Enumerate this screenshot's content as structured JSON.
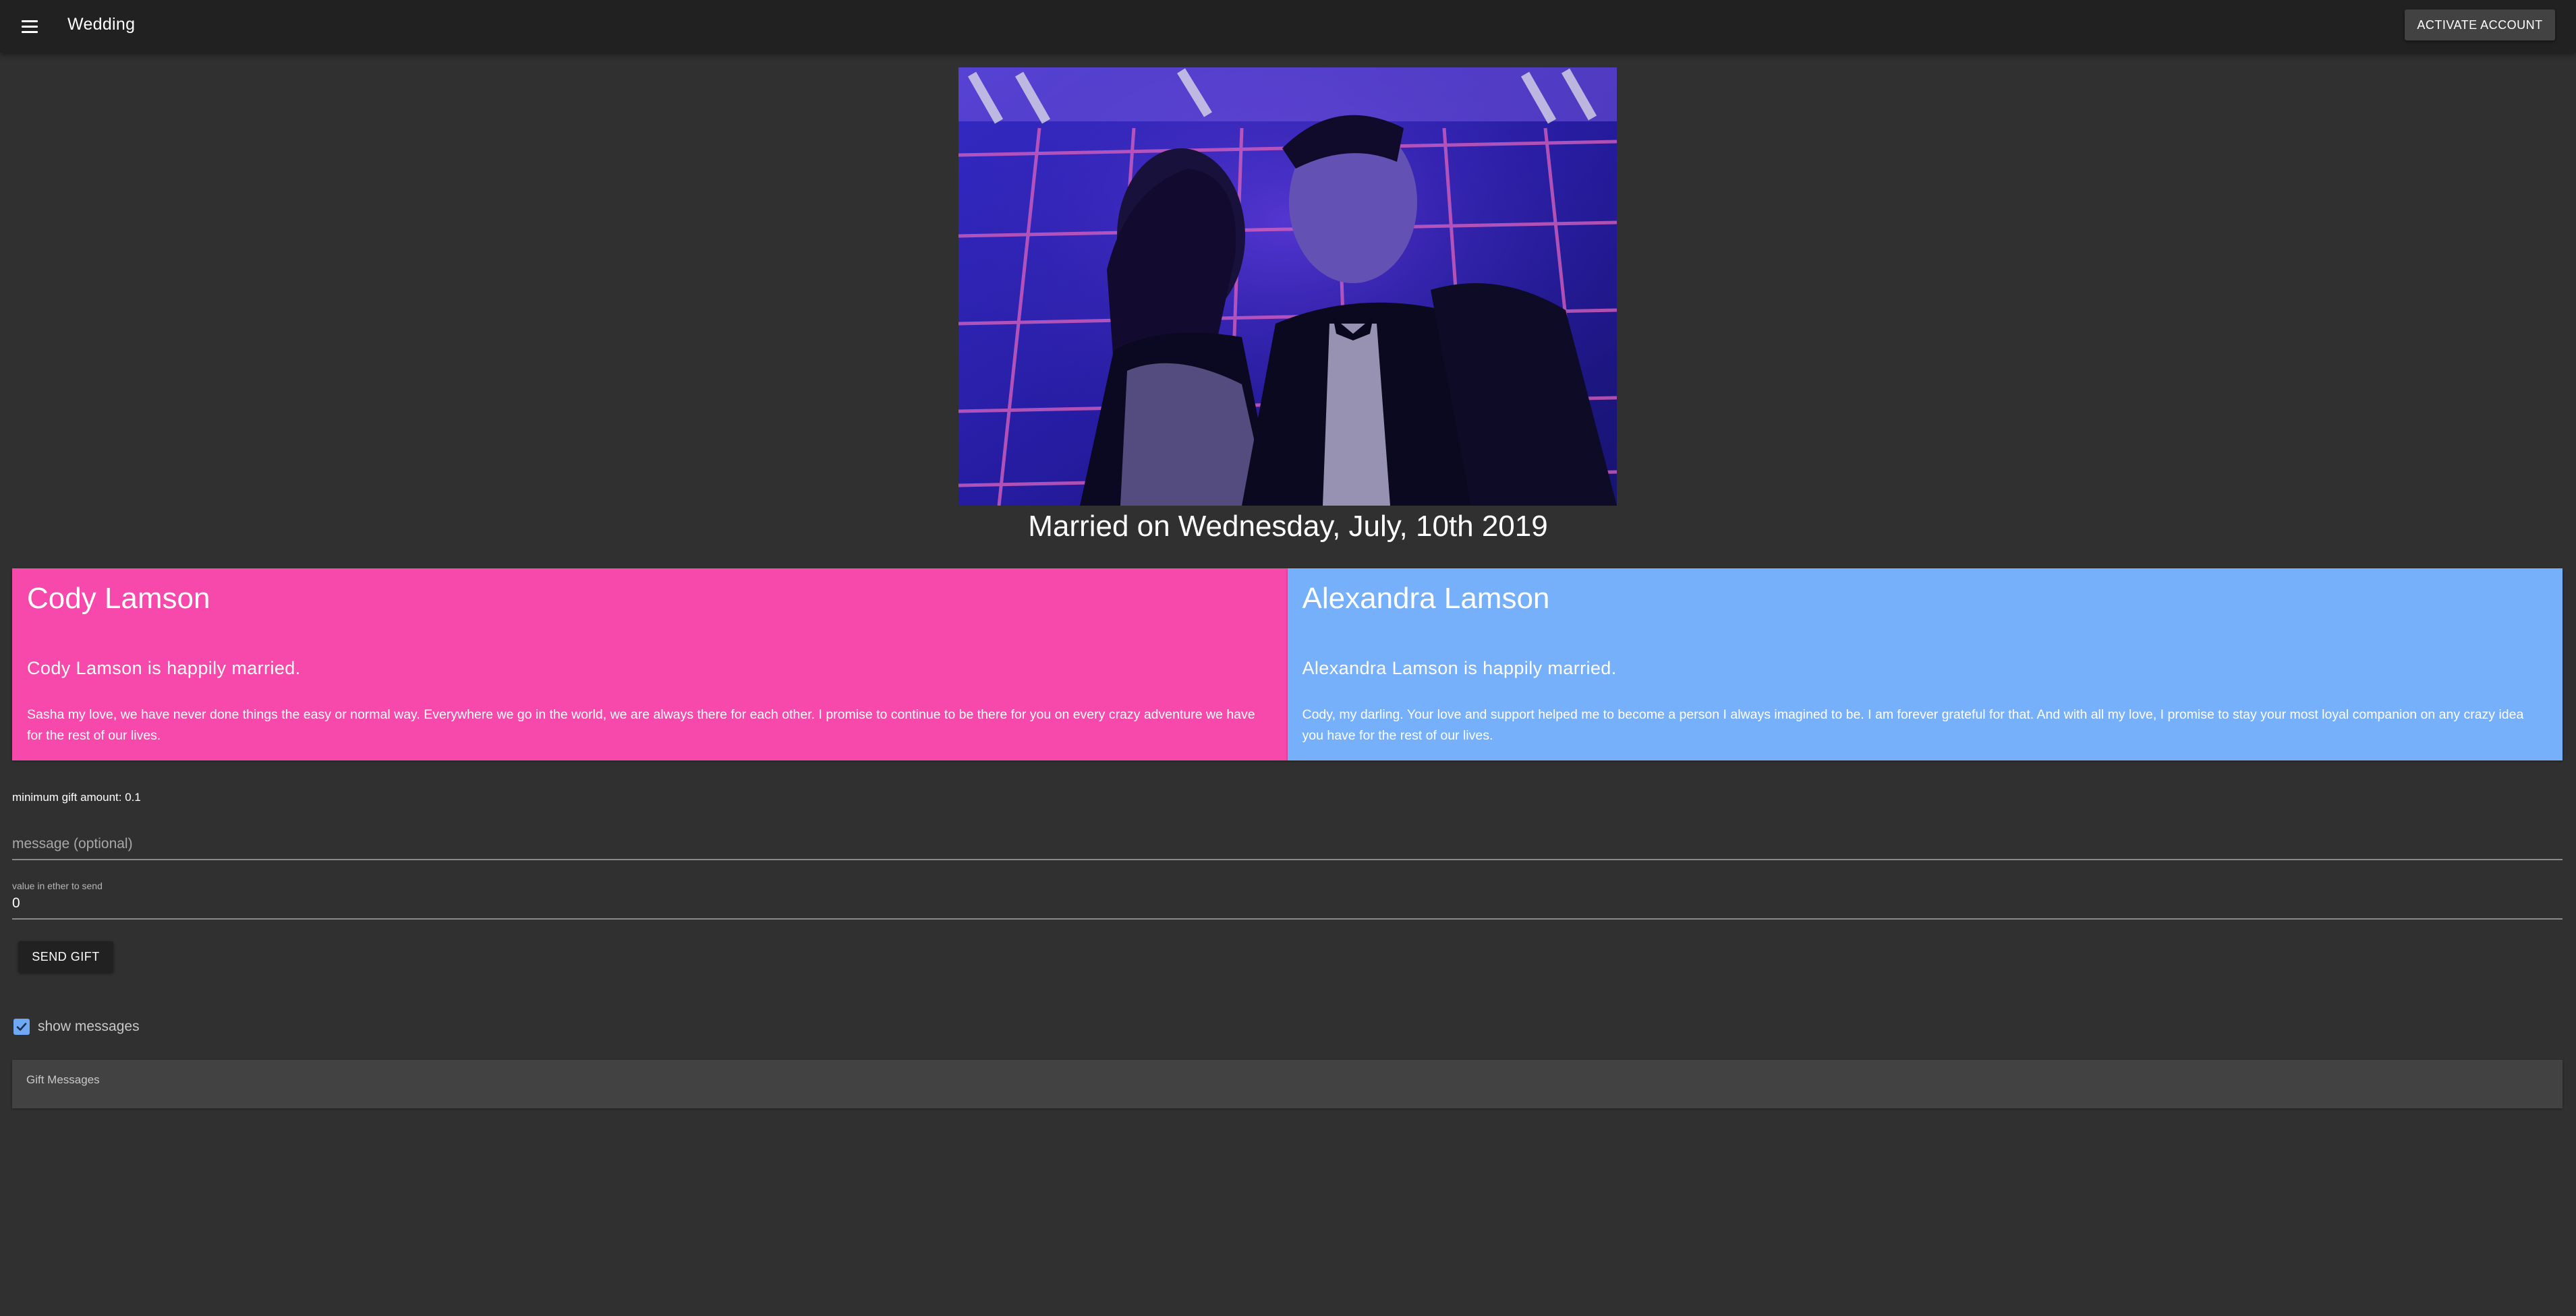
{
  "app_bar": {
    "menu_icon": "menu-icon",
    "title": "Wedding",
    "activate_label": "ACTIVATE ACCOUNT"
  },
  "hero": {
    "image_description": "couple-photo",
    "married_text": "Married on Wednesday, July, 10th 2019"
  },
  "partners": [
    {
      "name": "Cody Lamson",
      "status": "Cody Lamson is happily married.",
      "vow": "Sasha my love, we have never done things the easy or normal way. Everywhere we go in the world, we are always there for each other. I promise to continue to be there for you on every crazy adventure we have for the rest of our lives.",
      "color": "#f748ab"
    },
    {
      "name": "Alexandra Lamson",
      "status": "Alexandra Lamson is happily married.",
      "vow": "Cody, my darling. Your love and support helped me to become a person I always imagined to be. I am forever grateful for that. And with all my love, I promise to stay your most loyal companion on any crazy idea you have for the rest of our lives.",
      "color": "#76b0fb"
    }
  ],
  "gift_form": {
    "min_amount_text": "minimum gift amount: 0.1",
    "message_placeholder": "message (optional)",
    "message_value": "",
    "value_label": "value in ether to send",
    "value": "0",
    "send_label": "SEND GIFT"
  },
  "messages": {
    "show_label": "show messages",
    "show_checked": true,
    "panel_title": "Gift Messages"
  },
  "colors": {
    "background": "#303030",
    "app_bar": "#212121",
    "checkbox": "#6fa8f5",
    "panel": "#424242"
  }
}
